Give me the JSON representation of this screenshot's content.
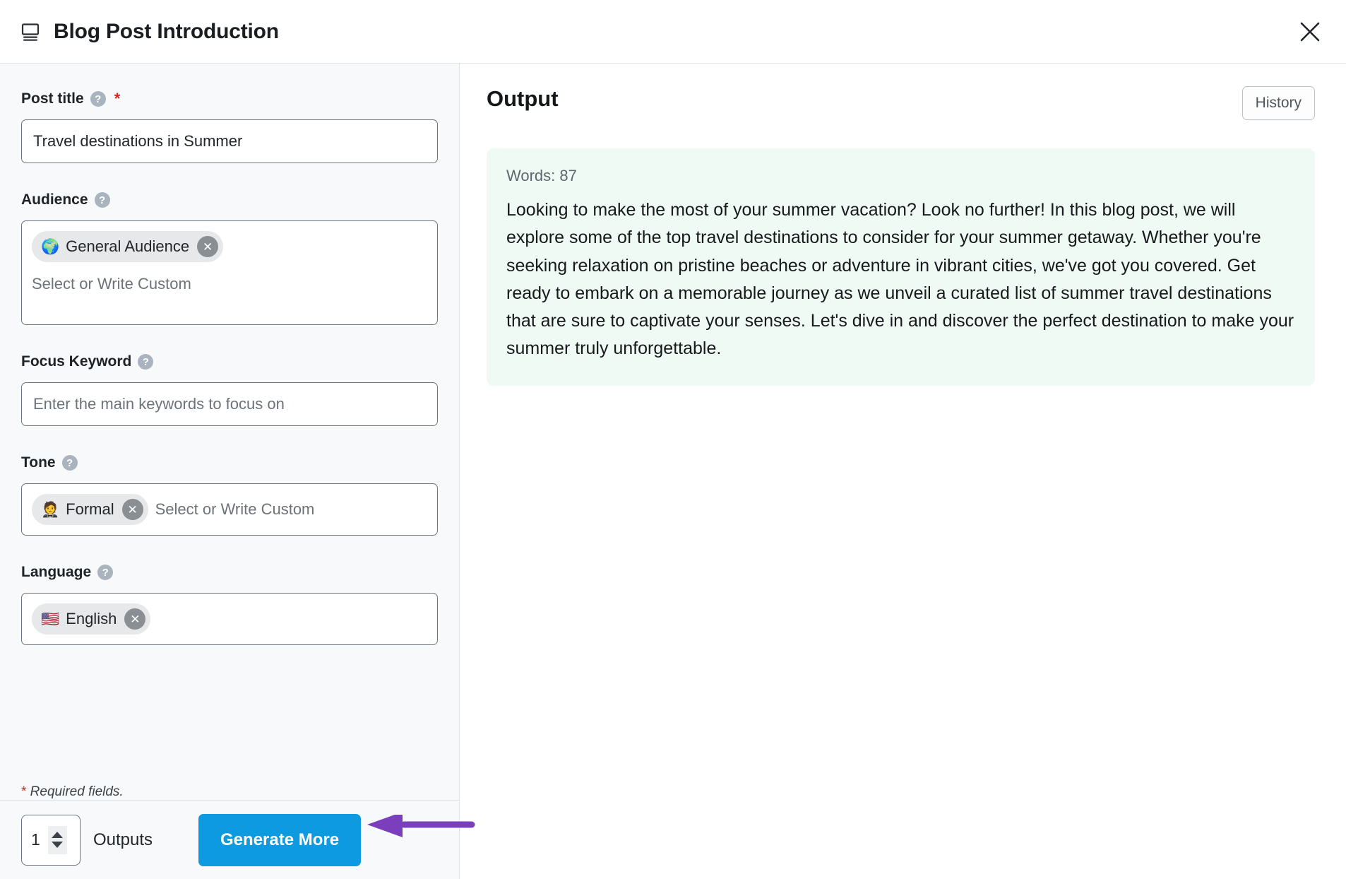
{
  "header": {
    "title": "Blog Post Introduction",
    "icon": "article-intro-icon",
    "close_label": "×"
  },
  "form": {
    "help_glyph": "?",
    "required_marker": "*",
    "required_note_star": "*",
    "required_note_text": " Required fields.",
    "fields": [
      {
        "label": "Post title",
        "required": true,
        "value": "Travel destinations in Summer",
        "placeholder": ""
      },
      {
        "label": "Audience",
        "required": false,
        "tag_emoji": "🌍",
        "tag_label": "General Audience",
        "tag_remove": "✕",
        "placeholder": "Select or Write Custom"
      },
      {
        "label": "Focus Keyword",
        "required": false,
        "value": "",
        "placeholder": "Enter the main keywords to focus on"
      },
      {
        "label": "Tone",
        "required": false,
        "tag_emoji": "🤵",
        "tag_label": "Formal",
        "tag_remove": "✕",
        "placeholder": "Select or Write Custom"
      },
      {
        "label": "Language",
        "required": false,
        "tag_emoji": "🇺🇸",
        "tag_label": "English",
        "tag_remove": "✕",
        "placeholder": ""
      }
    ]
  },
  "footer": {
    "outputs_value": "1",
    "outputs_label": "Outputs",
    "generate_label": "Generate More"
  },
  "output": {
    "title": "Output",
    "history_label": "History",
    "words_label": "Words: 87",
    "text": "Looking to make the most of your summer vacation? Look no further! In this blog post, we will explore some of the top travel destinations to consider for your summer getaway. Whether you're seeking relaxation on pristine beaches or adventure in vibrant cities, we've got you covered. Get ready to embark on a memorable journey as we unveil a curated list of summer travel destinations that are sure to captivate your senses. Let's dive in and discover the perfect destination to make your summer truly unforgettable."
  },
  "colors": {
    "accent_blue": "#0d9ae0",
    "annotation_purple": "#7b3fbe",
    "required_red": "#e02020",
    "output_card_bg": "#effaf4",
    "panel_bg": "#f7f9fa"
  }
}
